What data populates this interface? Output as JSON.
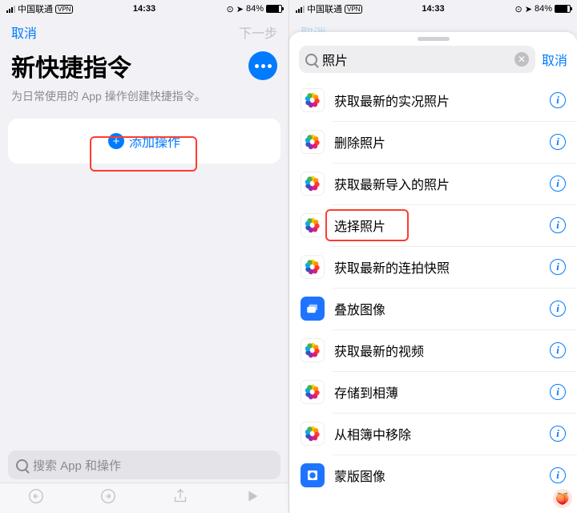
{
  "status": {
    "carrier": "中国联通",
    "vpn": "VPN",
    "time": "14:33",
    "battery": "84%",
    "nav_icon": "➤"
  },
  "left": {
    "cancel": "取消",
    "next": "下一步",
    "title": "新快捷指令",
    "subtitle": "为日常使用的 App 操作创建快捷指令。",
    "add_action": "添加操作",
    "search_placeholder": "搜索 App 和操作"
  },
  "right": {
    "dim_cancel": "取消",
    "search_value": "照片",
    "cancel": "取消",
    "actions": [
      {
        "label": "获取最新的实况照片",
        "icon": "photos"
      },
      {
        "label": "删除照片",
        "icon": "photos"
      },
      {
        "label": "获取最新导入的照片",
        "icon": "photos"
      },
      {
        "label": "选择照片",
        "icon": "photos",
        "highlight": true
      },
      {
        "label": "获取最新的连拍快照",
        "icon": "photos"
      },
      {
        "label": "叠放图像",
        "icon": "blue"
      },
      {
        "label": "获取最新的视频",
        "icon": "photos"
      },
      {
        "label": "存储到相薄",
        "icon": "photos"
      },
      {
        "label": "从相簿中移除",
        "icon": "photos"
      },
      {
        "label": "蒙版图像",
        "icon": "blue"
      }
    ]
  }
}
